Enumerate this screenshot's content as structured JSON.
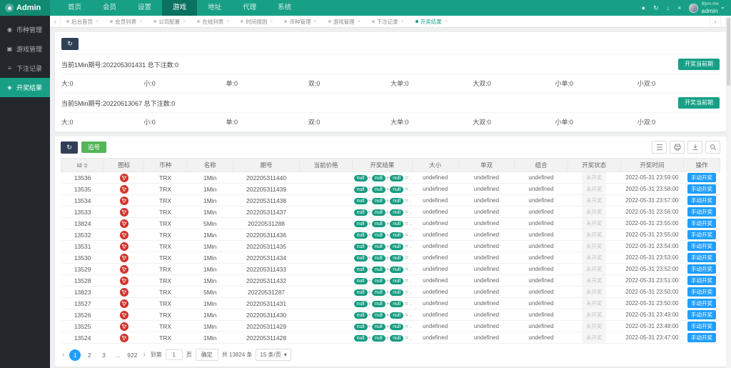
{
  "topbar": {
    "brand": "Admin",
    "nav": [
      {
        "label": "首页"
      },
      {
        "label": "会员"
      },
      {
        "label": "设置"
      },
      {
        "label": "游戏",
        "active": true
      },
      {
        "label": "地址"
      },
      {
        "label": "代理"
      },
      {
        "label": "系统"
      }
    ],
    "icons": {
      "theme": "●",
      "refresh": "↻",
      "download": "↓",
      "fullscreen": "×"
    },
    "watermark": "9lym.me",
    "user": "admin",
    "user_caret": "▾"
  },
  "sidebar": {
    "items": [
      {
        "label": "币种管理",
        "icon": "◉"
      },
      {
        "label": "游戏管理",
        "icon": "▣"
      },
      {
        "label": "下注记录",
        "icon": "≡"
      },
      {
        "label": "开奖结果",
        "icon": "◈",
        "active": true
      }
    ]
  },
  "tabbar": {
    "prev": "‹",
    "next": "›",
    "menu": "⋮",
    "close_glyph": "×",
    "tabs": [
      {
        "label": "后台首页"
      },
      {
        "label": "会员列表"
      },
      {
        "label": "公司配置"
      },
      {
        "label": "在线列表"
      },
      {
        "label": "时间规则"
      },
      {
        "label": "币种管理"
      },
      {
        "label": "游戏管理"
      },
      {
        "label": "下注记录"
      },
      {
        "label": "开奖结果",
        "active": true
      }
    ]
  },
  "panels": {
    "refresh_glyph": "↻",
    "p1": {
      "title": "当前1Min期号:202205301431 总下注数:0",
      "button": "开奖当前期",
      "stats": [
        "大:0",
        "小:0",
        "单:0",
        "双:0",
        "大单:0",
        "大双:0",
        "小单:0",
        "小双:0"
      ]
    },
    "p2": {
      "title": "当前5Min期号:20220613067 总下注数:0",
      "button": "开奖当前期",
      "stats": [
        "大:0",
        "小:0",
        "单:0",
        "双:0",
        "大单:0",
        "大双:0",
        "小单:0",
        "小双:0"
      ]
    }
  },
  "table": {
    "refresh_glyph": "↻",
    "green_button": "追号",
    "columns": [
      "id",
      "图标",
      "币种",
      "名称",
      "期号",
      "当前价格",
      "开奖结果",
      "大小",
      "单双",
      "组合",
      "开奖状态",
      "开奖时间",
      "操作"
    ],
    "result": {
      "badges": [
        "null",
        "null",
        "null"
      ],
      "plus": "+",
      "suffix": "= ..."
    },
    "undefined_label": "undefined",
    "status_label": "未开奖",
    "action_label": "手动开奖",
    "rows": [
      {
        "id": "13536",
        "coin": "TRX",
        "name": "1Min",
        "issue": "202205311440",
        "time": "2022-05-31 23:59:00"
      },
      {
        "id": "13535",
        "coin": "TRX",
        "name": "1Min",
        "issue": "202205311439",
        "time": "2022-05-31 23:58:00"
      },
      {
        "id": "13534",
        "coin": "TRX",
        "name": "1Min",
        "issue": "202205311438",
        "time": "2022-05-31 23:57:00"
      },
      {
        "id": "13533",
        "coin": "TRX",
        "name": "1Min",
        "issue": "202205311437",
        "time": "2022-05-31 23:56:00"
      },
      {
        "id": "13824",
        "coin": "TRX",
        "name": "5Min",
        "issue": "20220531288",
        "time": "2022-05-31 23:55:00"
      },
      {
        "id": "13532",
        "coin": "TRX",
        "name": "1Min",
        "issue": "202205311436",
        "time": "2022-05-31 23:55:00"
      },
      {
        "id": "13531",
        "coin": "TRX",
        "name": "1Min",
        "issue": "202205311435",
        "time": "2022-05-31 23:54:00"
      },
      {
        "id": "13530",
        "coin": "TRX",
        "name": "1Min",
        "issue": "202205311434",
        "time": "2022-05-31 23:53:00"
      },
      {
        "id": "13529",
        "coin": "TRX",
        "name": "1Min",
        "issue": "202205311433",
        "time": "2022-05-31 23:52:00"
      },
      {
        "id": "13528",
        "coin": "TRX",
        "name": "1Min",
        "issue": "202205311432",
        "time": "2022-05-31 23:51:00"
      },
      {
        "id": "13823",
        "coin": "TRX",
        "name": "5Min",
        "issue": "20220531287",
        "time": "2022-05-31 23:50:00"
      },
      {
        "id": "13527",
        "coin": "TRX",
        "name": "1Min",
        "issue": "202205311431",
        "time": "2022-05-31 23:50:00"
      },
      {
        "id": "13526",
        "coin": "TRX",
        "name": "1Min",
        "issue": "202205311430",
        "time": "2022-05-31 23:49:00"
      },
      {
        "id": "13525",
        "coin": "TRX",
        "name": "1Min",
        "issue": "202205311429",
        "time": "2022-05-31 23:48:00"
      },
      {
        "id": "13524",
        "coin": "TRX",
        "name": "1Min",
        "issue": "202205311428",
        "time": "2022-05-31 23:47:00"
      }
    ]
  },
  "pagination": {
    "prev": "‹",
    "next": "›",
    "pages": [
      {
        "label": "1",
        "current": true
      },
      {
        "label": "2"
      },
      {
        "label": "3"
      },
      {
        "label": "..."
      },
      {
        "label": "922"
      }
    ],
    "jump_label": "到第",
    "jump_value": "1",
    "jump_suffix": "页",
    "confirm": "确定",
    "total": "共 13824 条",
    "per_page": "15 条/页",
    "per_page_caret": "▾"
  }
}
